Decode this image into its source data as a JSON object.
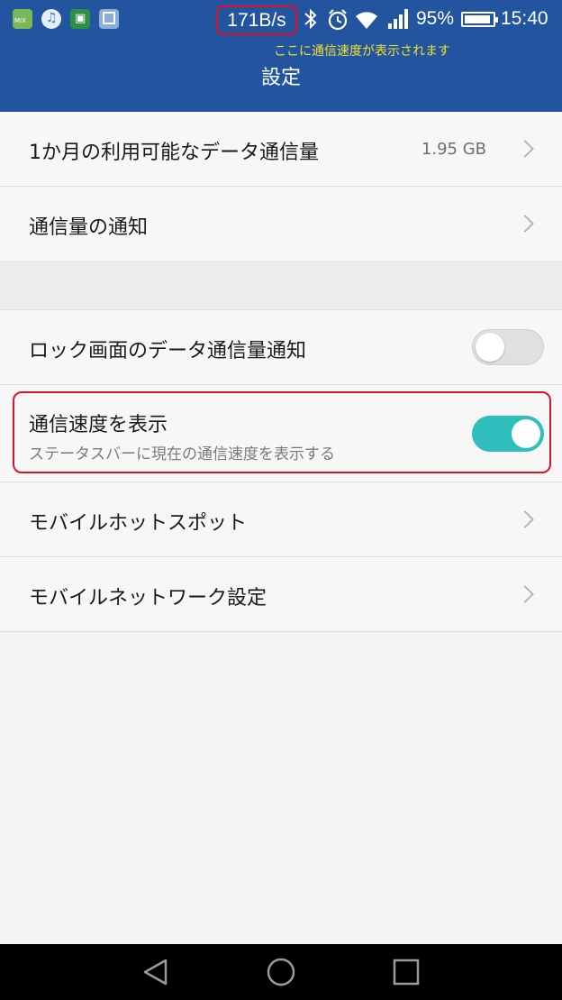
{
  "status_bar": {
    "app_icons": [
      "mix-app-icon",
      "music-app-icon",
      "transit-app-icon",
      "gallery-app-icon"
    ],
    "app_icon_mix_text": "MIX",
    "net_speed": "171B/s",
    "battery_percent": "95%",
    "time": "15:40",
    "icons": [
      "bluetooth-icon",
      "alarm-icon",
      "wifi-icon",
      "signal-icon",
      "battery-icon"
    ]
  },
  "annotation": "ここに通信速度が表示されます",
  "header": {
    "title": "設定"
  },
  "settings": {
    "data_limit": {
      "label": "1か月の利用可能なデータ通信量",
      "value": "1.95 GB"
    },
    "usage_notification": {
      "label": "通信量の通知"
    },
    "lock_screen_notification": {
      "label": "ロック画面のデータ通信量通知",
      "enabled": false
    },
    "show_speed": {
      "label": "通信速度を表示",
      "description": "ステータスバーに現在の通信速度を表示する",
      "enabled": true
    },
    "hotspot": {
      "label": "モバイルホットスポット"
    },
    "mobile_network": {
      "label": "モバイルネットワーク設定"
    }
  },
  "nav_bar": {
    "buttons": [
      "back-icon",
      "home-icon",
      "recent-apps-icon"
    ]
  },
  "colors": {
    "header": "#2254a0",
    "toggle_on": "#30bebd",
    "highlight": "#d6142d",
    "annotation": "#f2e02a"
  }
}
